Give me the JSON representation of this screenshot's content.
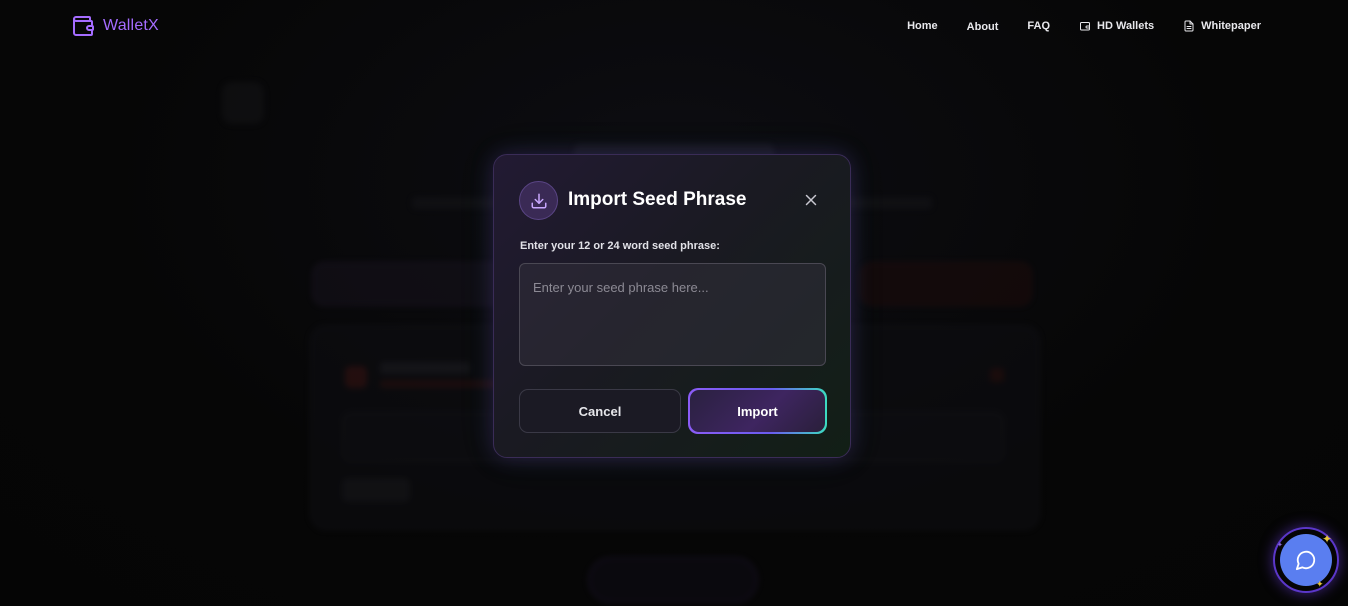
{
  "header": {
    "brand": "WalletX",
    "nav": [
      {
        "label": "Home",
        "icon": null
      },
      {
        "label": "About",
        "icon": null
      },
      {
        "label": "FAQ",
        "icon": null
      },
      {
        "label": "HD Wallets",
        "icon": "wallet-icon"
      },
      {
        "label": "Whitepaper",
        "icon": "document-icon"
      }
    ]
  },
  "modal": {
    "title": "Import Seed Phrase",
    "icon": "download-icon",
    "label": "Enter your 12 or 24 word seed phrase:",
    "textarea_placeholder": "Enter your seed phrase here...",
    "textarea_value": "",
    "cancel_label": "Cancel",
    "import_label": "Import"
  },
  "colors": {
    "accent_purple": "#8b5cf6",
    "accent_teal": "#3cdcc0",
    "chat_blue": "#5a7ef0",
    "brand": "#a56cff"
  },
  "chat": {
    "icon": "chat-bubble-icon"
  }
}
